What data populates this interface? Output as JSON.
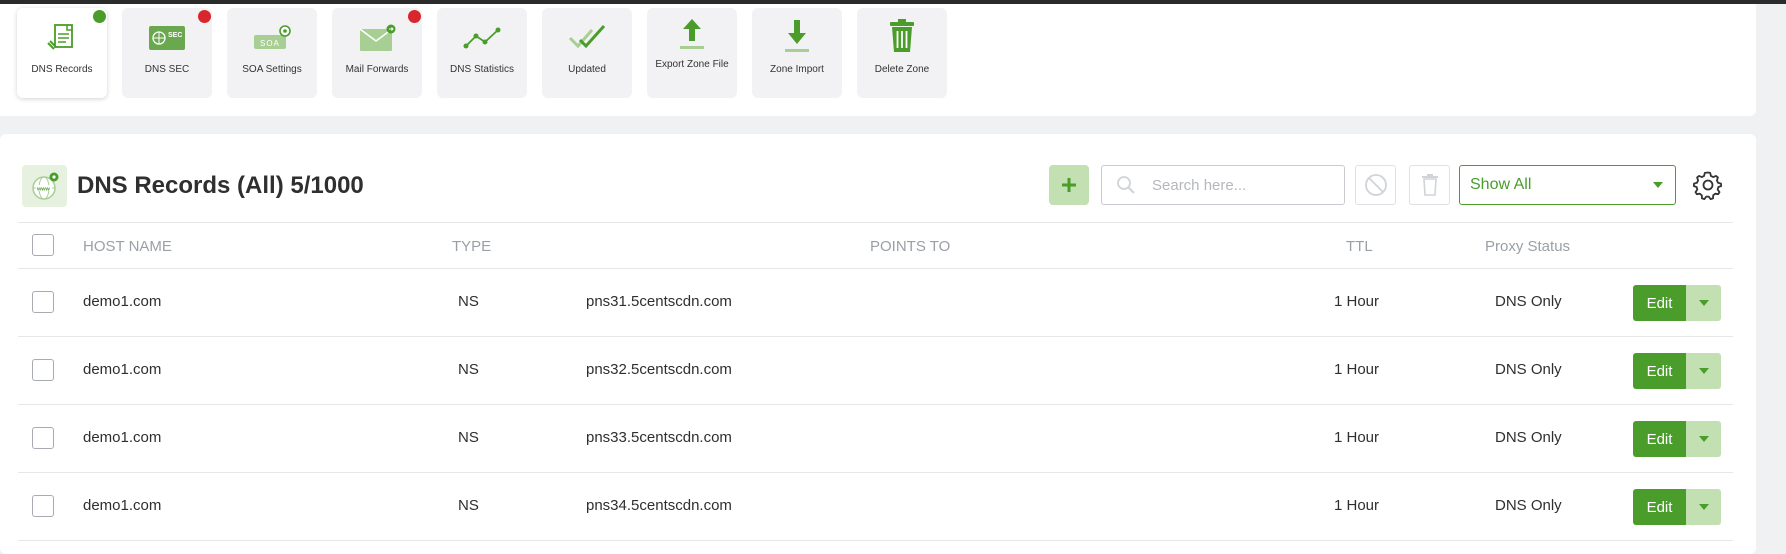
{
  "toolbar": {
    "items": [
      {
        "label": "DNS Records",
        "icon": "dns-records-icon",
        "badge": "green"
      },
      {
        "label": "DNS SEC",
        "icon": "dnssec-icon",
        "badge": "red"
      },
      {
        "label": "SOA Settings",
        "icon": "soa-icon"
      },
      {
        "label": "Mail Forwards",
        "icon": "mail-icon",
        "badge": "red"
      },
      {
        "label": "DNS Statistics",
        "icon": "statistics-icon"
      },
      {
        "label": "Updated",
        "icon": "check-icon"
      },
      {
        "label": "Export Zone File",
        "icon": "upload-icon"
      },
      {
        "label": "Zone Import",
        "icon": "download-icon"
      },
      {
        "label": "Delete Zone",
        "icon": "trash-icon"
      }
    ]
  },
  "records": {
    "title": "DNS Records (All) 5/1000",
    "search_placeholder": "Search here...",
    "filter_selected": "Show All",
    "columns": [
      "HOST NAME",
      "TYPE",
      "POINTS TO",
      "TTL",
      "Proxy Status"
    ],
    "rows": [
      {
        "host": "demo1.com",
        "type": "NS",
        "points_to": "pns31.5centscdn.com",
        "ttl": "1 Hour",
        "proxy": "DNS Only"
      },
      {
        "host": "demo1.com",
        "type": "NS",
        "points_to": "pns32.5centscdn.com",
        "ttl": "1 Hour",
        "proxy": "DNS Only"
      },
      {
        "host": "demo1.com",
        "type": "NS",
        "points_to": "pns33.5centscdn.com",
        "ttl": "1 Hour",
        "proxy": "DNS Only"
      },
      {
        "host": "demo1.com",
        "type": "NS",
        "points_to": "pns34.5centscdn.com",
        "ttl": "1 Hour",
        "proxy": "DNS Only"
      }
    ],
    "edit_label": "Edit"
  },
  "colors": {
    "accent": "#4a9d2a",
    "accent_light": "#c2e0b2",
    "badge_red": "#d9262c"
  }
}
